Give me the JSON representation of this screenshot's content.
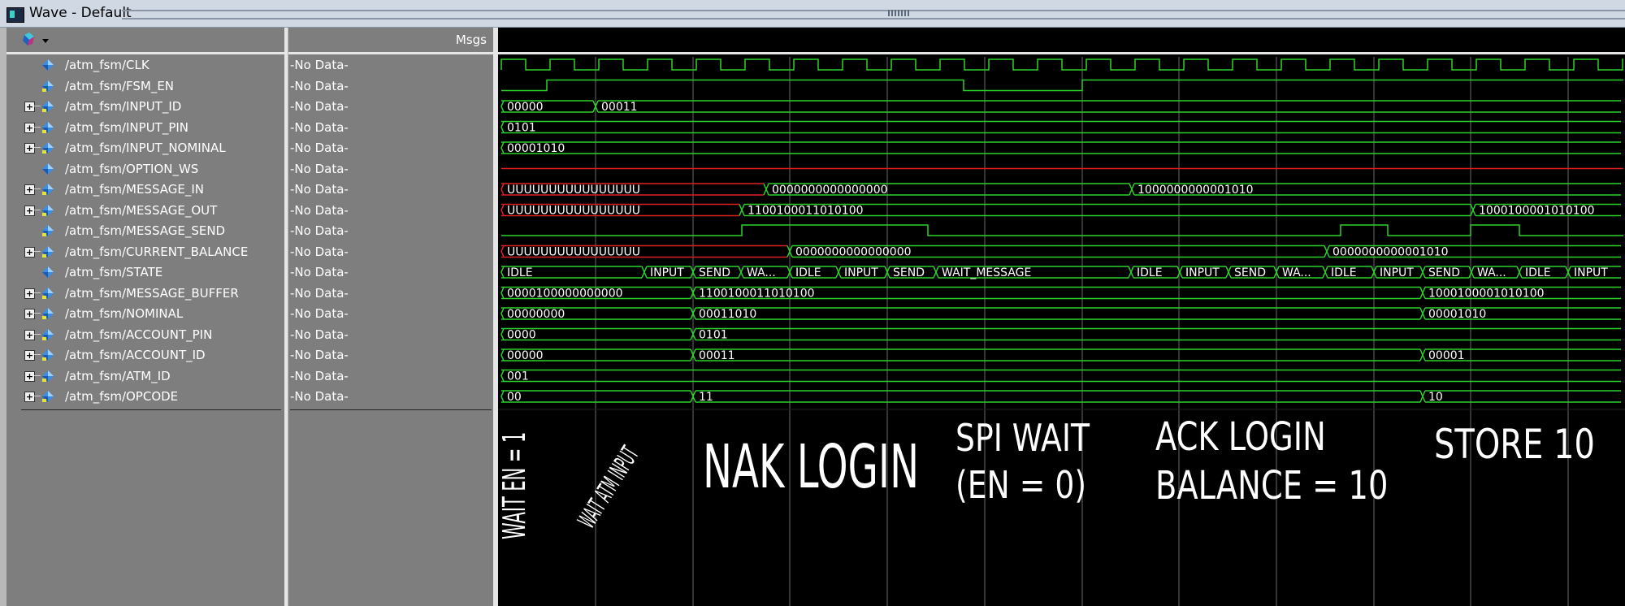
{
  "window": {
    "title": "Wave - Default"
  },
  "panes": {
    "values_header": "Msgs"
  },
  "signals": [
    {
      "name": "/atm_fsm/CLK",
      "value": "-No Data-",
      "expandable": false
    },
    {
      "name": "/atm_fsm/FSM_EN",
      "value": "-No Data-",
      "expandable": false
    },
    {
      "name": "/atm_fsm/INPUT_ID",
      "value": "-No Data-",
      "expandable": true
    },
    {
      "name": "/atm_fsm/INPUT_PIN",
      "value": "-No Data-",
      "expandable": true
    },
    {
      "name": "/atm_fsm/INPUT_NOMINAL",
      "value": "-No Data-",
      "expandable": true
    },
    {
      "name": "/atm_fsm/OPTION_WS",
      "value": "-No Data-",
      "expandable": false
    },
    {
      "name": "/atm_fsm/MESSAGE_IN",
      "value": "-No Data-",
      "expandable": true
    },
    {
      "name": "/atm_fsm/MESSAGE_OUT",
      "value": "-No Data-",
      "expandable": true
    },
    {
      "name": "/atm_fsm/MESSAGE_SEND",
      "value": "-No Data-",
      "expandable": false
    },
    {
      "name": "/atm_fsm/CURRENT_BALANCE",
      "value": "-No Data-",
      "expandable": true
    },
    {
      "name": "/atm_fsm/STATE",
      "value": "-No Data-",
      "expandable": false
    },
    {
      "name": "/atm_fsm/MESSAGE_BUFFER",
      "value": "-No Data-",
      "expandable": true
    },
    {
      "name": "/atm_fsm/NOMINAL",
      "value": "-No Data-",
      "expandable": true
    },
    {
      "name": "/atm_fsm/ACCOUNT_PIN",
      "value": "-No Data-",
      "expandable": true
    },
    {
      "name": "/atm_fsm/ACCOUNT_ID",
      "value": "-No Data-",
      "expandable": true
    },
    {
      "name": "/atm_fsm/ATM_ID",
      "value": "-No Data-",
      "expandable": true
    },
    {
      "name": "/atm_fsm/OPCODE",
      "value": "-No Data-",
      "expandable": true
    }
  ],
  "waves": {
    "input_id": [
      "00000",
      "00011"
    ],
    "input_pin": [
      "0101"
    ],
    "input_nominal": [
      "00001010"
    ],
    "message_in": [
      "UUUUUUUUUUUUUUUU",
      "0000000000000000",
      "1000000000001010"
    ],
    "message_out": [
      "UUUUUUUUUUUUUUUU",
      "1100100011010100",
      "1000100001010100"
    ],
    "current_balance": [
      "UUUUUUUUUUUUUUUU",
      "0000000000000000",
      "0000000000001010"
    ],
    "state": [
      "IDLE",
      "INPUT",
      "SEND",
      "WA...",
      "IDLE",
      "INPUT",
      "SEND",
      "WAIT_MESSAGE",
      "IDLE",
      "INPUT",
      "SEND",
      "WA...",
      "IDLE",
      "INPUT",
      "SEND",
      "WA...",
      "IDLE",
      "INPUT"
    ],
    "message_buffer": [
      "0000100000000000",
      "1100100011010100",
      "1000100001010100"
    ],
    "nominal": [
      "00000000",
      "00011010",
      "00001010"
    ],
    "account_pin": [
      "0000",
      "0101"
    ],
    "account_id": [
      "00000",
      "00011",
      "00001"
    ],
    "atm_id": [
      "001"
    ],
    "opcode": [
      "00",
      "11",
      "10"
    ]
  },
  "annotations": {
    "wait_en": "WAIT EN = 1",
    "wait_atm": "WAIT ATM INPUT",
    "nak": "NAK LOGIN",
    "spi_wait_1": "SPI WAIT",
    "spi_wait_2": "(EN = 0)",
    "ack_1": "ACK LOGIN",
    "ack_2": "BALANCE = 10",
    "store": "STORE 10"
  },
  "colors": {
    "wave": "#2ad22a",
    "undefined": "#e02020",
    "background": "#000000",
    "pane": "#7e7e7e"
  }
}
